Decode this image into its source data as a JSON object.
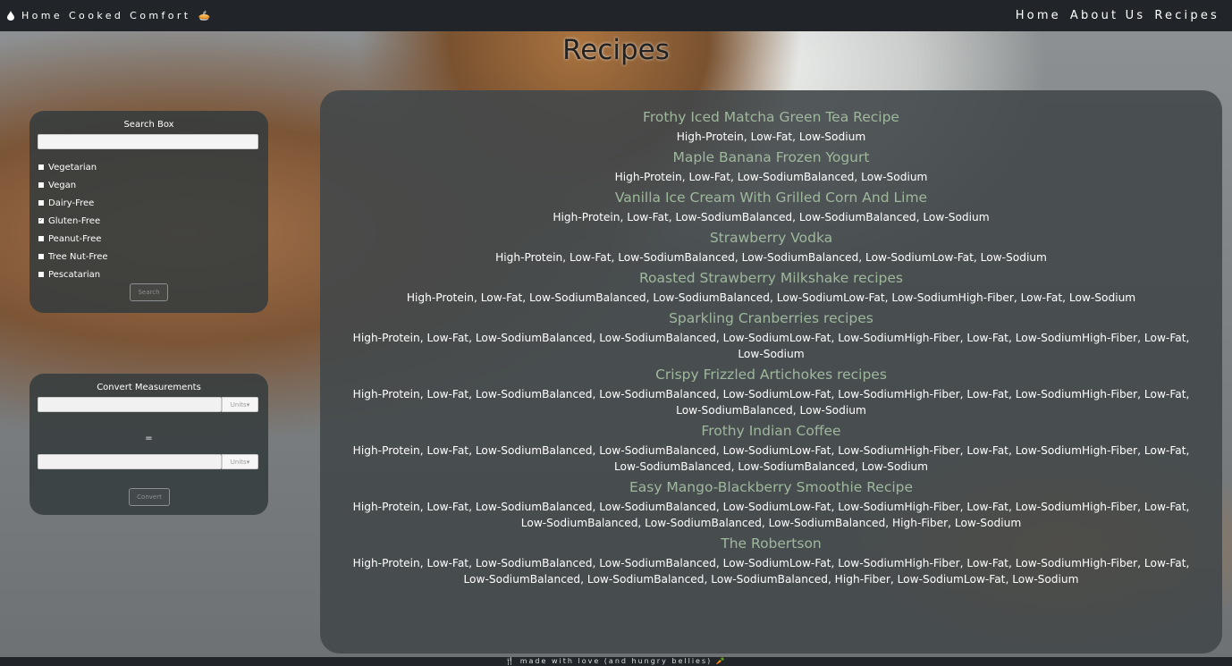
{
  "nav": {
    "brand": "Home Cooked Comfort",
    "brand_emoji": "🥧",
    "links": [
      "Home",
      "About Us",
      "Recipes"
    ]
  },
  "page": {
    "title": "Recipes"
  },
  "search_box": {
    "title": "Search Box",
    "input_value": "",
    "filters": [
      {
        "label": "Vegetarian",
        "checked": false
      },
      {
        "label": "Vegan",
        "checked": false
      },
      {
        "label": "Dairy-Free",
        "checked": false
      },
      {
        "label": "Gluten-Free",
        "checked": true
      },
      {
        "label": "Peanut-Free",
        "checked": false
      },
      {
        "label": "Tree Nut-Free",
        "checked": false
      },
      {
        "label": "Pescatarian",
        "checked": false
      }
    ],
    "button": "Search"
  },
  "converter": {
    "title": "Convert Measurements",
    "units_label": "Units",
    "equals": "=",
    "button": "Convert"
  },
  "recipes": [
    {
      "name": "Frothy Iced Matcha Green Tea Recipe",
      "tags": "High-Protein, Low-Fat, Low-Sodium"
    },
    {
      "name": "Maple Banana Frozen Yogurt",
      "tags": "High-Protein, Low-Fat, Low-SodiumBalanced, Low-Sodium"
    },
    {
      "name": "Vanilla Ice Cream With Grilled Corn And Lime",
      "tags": "High-Protein, Low-Fat, Low-SodiumBalanced, Low-SodiumBalanced, Low-Sodium"
    },
    {
      "name": "Strawberry Vodka",
      "tags": "High-Protein, Low-Fat, Low-SodiumBalanced, Low-SodiumBalanced, Low-SodiumLow-Fat, Low-Sodium"
    },
    {
      "name": "Roasted Strawberry Milkshake recipes",
      "tags": "High-Protein, Low-Fat, Low-SodiumBalanced, Low-SodiumBalanced, Low-SodiumLow-Fat, Low-SodiumHigh-Fiber, Low-Fat, Low-Sodium"
    },
    {
      "name": "Sparkling Cranberries recipes",
      "tags": "High-Protein, Low-Fat, Low-SodiumBalanced, Low-SodiumBalanced, Low-SodiumLow-Fat, Low-SodiumHigh-Fiber, Low-Fat, Low-SodiumHigh-Fiber, Low-Fat, Low-Sodium"
    },
    {
      "name": "Crispy Frizzled Artichokes recipes",
      "tags": "High-Protein, Low-Fat, Low-SodiumBalanced, Low-SodiumBalanced, Low-SodiumLow-Fat, Low-SodiumHigh-Fiber, Low-Fat, Low-SodiumHigh-Fiber, Low-Fat, Low-SodiumBalanced, Low-Sodium"
    },
    {
      "name": "Frothy Indian Coffee",
      "tags": "High-Protein, Low-Fat, Low-SodiumBalanced, Low-SodiumBalanced, Low-SodiumLow-Fat, Low-SodiumHigh-Fiber, Low-Fat, Low-SodiumHigh-Fiber, Low-Fat, Low-SodiumBalanced, Low-SodiumBalanced, Low-Sodium"
    },
    {
      "name": "Easy Mango-Blackberry Smoothie Recipe",
      "tags": "High-Protein, Low-Fat, Low-SodiumBalanced, Low-SodiumBalanced, Low-SodiumLow-Fat, Low-SodiumHigh-Fiber, Low-Fat, Low-SodiumHigh-Fiber, Low-Fat, Low-SodiumBalanced, Low-SodiumBalanced, Low-SodiumBalanced, High-Fiber, Low-Sodium"
    },
    {
      "name": "The Robertson",
      "tags": "High-Protein, Low-Fat, Low-SodiumBalanced, Low-SodiumBalanced, Low-SodiumLow-Fat, Low-SodiumHigh-Fiber, Low-Fat, Low-SodiumHigh-Fiber, Low-Fat, Low-SodiumBalanced, Low-SodiumBalanced, Low-SodiumBalanced, High-Fiber, Low-SodiumLow-Fat, Low-Sodium"
    }
  ],
  "footer": {
    "icon_left": "🍴",
    "text": "made with love (and hungry bellies)",
    "icon_right": "🥕"
  }
}
